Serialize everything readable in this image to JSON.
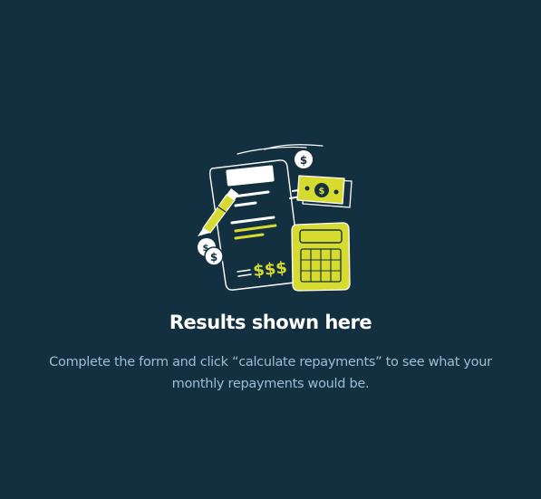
{
  "results": {
    "title": "Results shown here",
    "description": "Complete the form and click “calculate repayments” to see what your monthly repayments would be.",
    "illustration": {
      "icon": "empty-results-illustration",
      "document_symbols": "$$$",
      "coin_symbol": "$",
      "colors": {
        "background": "#133041",
        "accent": "#D8DB2F",
        "line": "#FFFFFF",
        "text_muted": "#9ABED5"
      }
    }
  }
}
